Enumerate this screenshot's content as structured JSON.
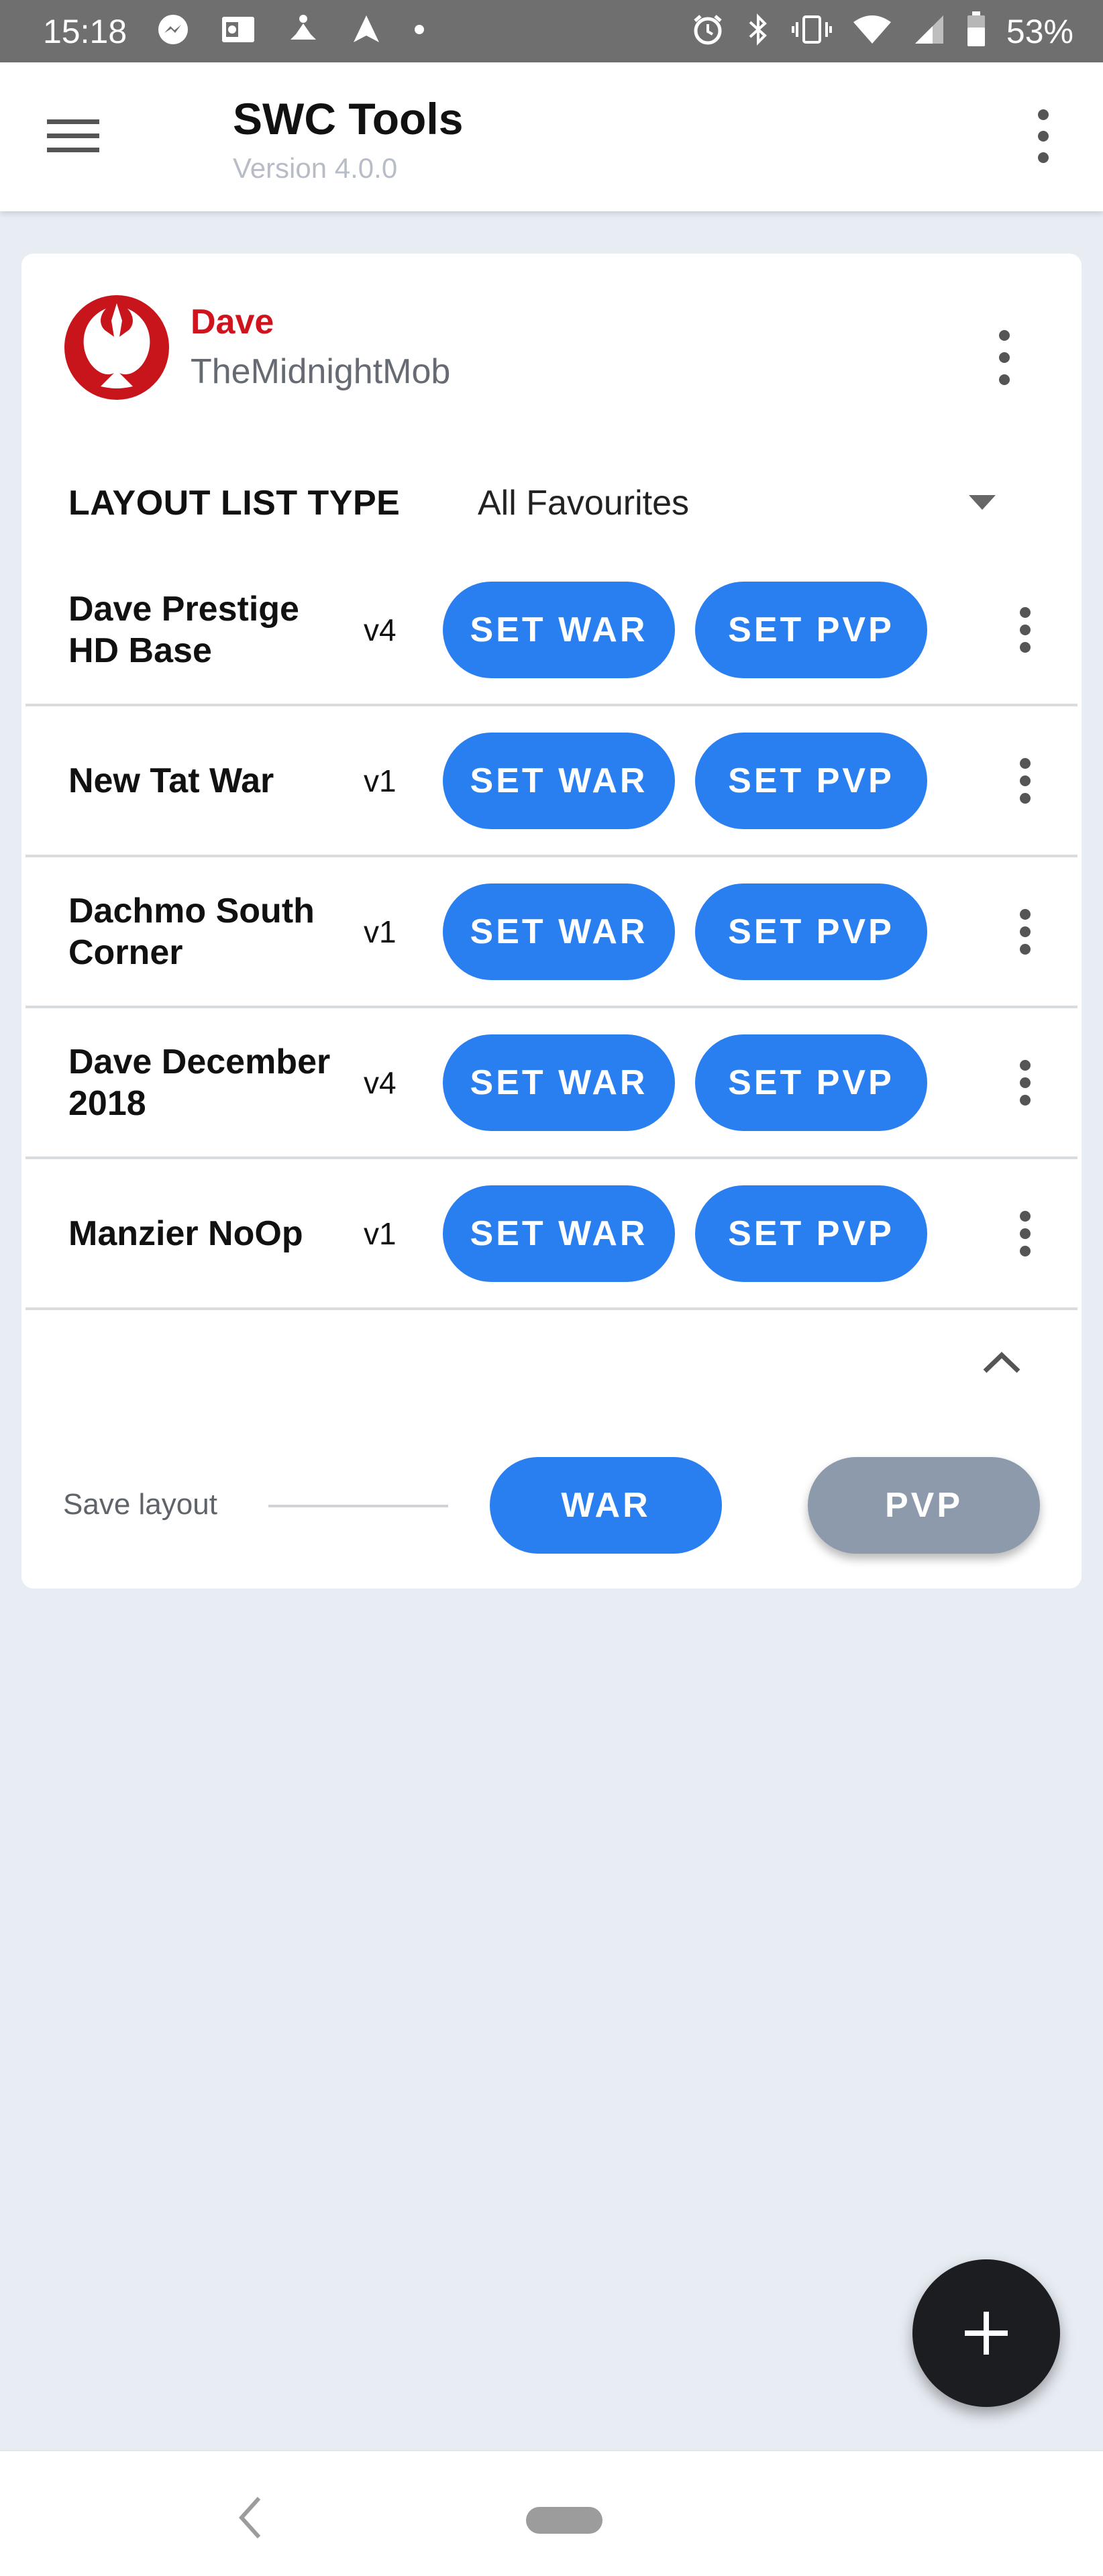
{
  "status_bar": {
    "time": "15:18",
    "battery": "53%",
    "left_icons": [
      "messenger-icon",
      "outlook-icon",
      "meditation-icon",
      "navigation-icon",
      "dot-icon"
    ],
    "right_icons": [
      "alarm-icon",
      "bluetooth-icon",
      "vibrate-icon",
      "wifi-icon",
      "signal-icon",
      "battery-icon"
    ]
  },
  "app_bar": {
    "title": "SWC Tools",
    "version": "Version 4.0.0"
  },
  "profile": {
    "name": "Dave",
    "guild": "TheMidnightMob",
    "name_color": "#d0141d"
  },
  "layout_type": {
    "label": "LAYOUT LIST TYPE",
    "value": "All Favourites"
  },
  "layouts": [
    {
      "name": "Dave Prestige HD Base",
      "version": "v4",
      "war_label": "SET WAR",
      "pvp_label": "SET PVP"
    },
    {
      "name": "New Tat War",
      "version": "v1",
      "war_label": "SET WAR",
      "pvp_label": "SET PVP"
    },
    {
      "name": "Dachmo South Corner",
      "version": "v1",
      "war_label": "SET WAR",
      "pvp_label": "SET PVP"
    },
    {
      "name": "Dave December 2018",
      "version": "v4",
      "war_label": "SET WAR",
      "pvp_label": "SET PVP"
    },
    {
      "name": "Manzier NoOp",
      "version": "v1",
      "war_label": "SET WAR",
      "pvp_label": "SET PVP"
    }
  ],
  "save": {
    "label": "Save layout",
    "war_label": "WAR",
    "pvp_label": "PVP"
  },
  "colors": {
    "accent": "#2a7ff0",
    "disabled": "#8d9aab",
    "background": "#e8edf4",
    "fab": "#1c1d21"
  }
}
